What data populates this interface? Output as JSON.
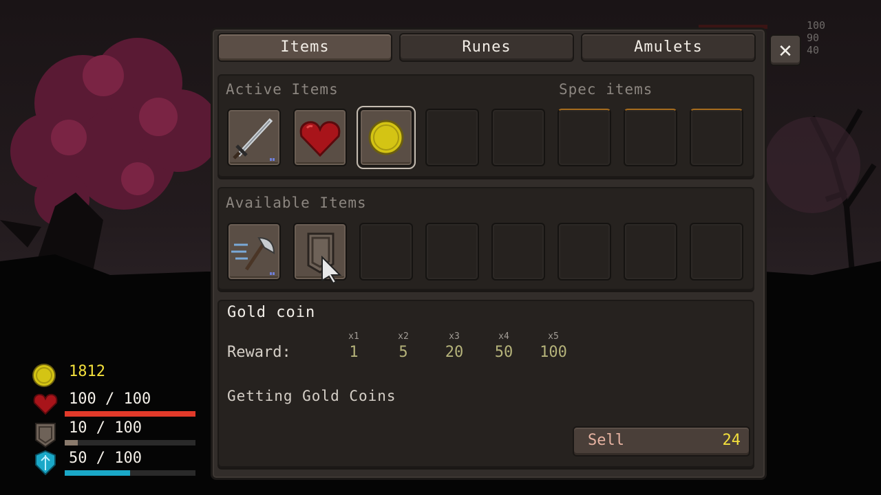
{
  "tabs": [
    {
      "label": "Items",
      "active": true
    },
    {
      "label": "Runes",
      "active": false
    },
    {
      "label": "Amulets",
      "active": false
    }
  ],
  "close_icon": "close-icon",
  "active_section": {
    "label": "Active Items",
    "spec_label": "Spec items",
    "slots": [
      {
        "icon": "sword-icon",
        "filled": true
      },
      {
        "icon": "heart-icon",
        "filled": true
      },
      {
        "icon": "gold-coin-icon",
        "filled": true,
        "selected": true
      },
      {
        "icon": null,
        "filled": false
      },
      {
        "icon": null,
        "filled": false
      }
    ],
    "spec_slots": 3
  },
  "available_section": {
    "label": "Available Items",
    "slots": [
      {
        "icon": "axe-icon",
        "filled": true
      },
      {
        "icon": "shield-icon",
        "filled": true
      },
      {
        "icon": null
      },
      {
        "icon": null
      },
      {
        "icon": null
      },
      {
        "icon": null
      },
      {
        "icon": null
      },
      {
        "icon": null
      }
    ]
  },
  "details": {
    "title": "Gold coin",
    "reward_label": "Reward:",
    "multipliers": [
      {
        "x": "x1",
        "value": "1"
      },
      {
        "x": "x2",
        "value": "5"
      },
      {
        "x": "x3",
        "value": "20"
      },
      {
        "x": "x4",
        "value": "50"
      },
      {
        "x": "x5",
        "value": "100"
      }
    ],
    "description": "Getting Gold Coins",
    "sell_label": "Sell",
    "sell_price": "24"
  },
  "hud": {
    "gold": "1812",
    "health": {
      "text": "100 / 100",
      "fraction": 1.0,
      "color": "#e23a2a"
    },
    "armor": {
      "text": "10 / 100",
      "fraction": 0.1,
      "color": "#8a7a6c"
    },
    "shield": {
      "text": "50 / 100",
      "fraction": 0.5,
      "color": "#1aa8c8"
    }
  },
  "enemy_stats": [
    "100",
    "90",
    "40"
  ],
  "colors": {
    "gold": "#d4c414",
    "health": "#e23a2a",
    "mana": "#1aa8c8",
    "spec_slot_border": "#a76c1d"
  }
}
